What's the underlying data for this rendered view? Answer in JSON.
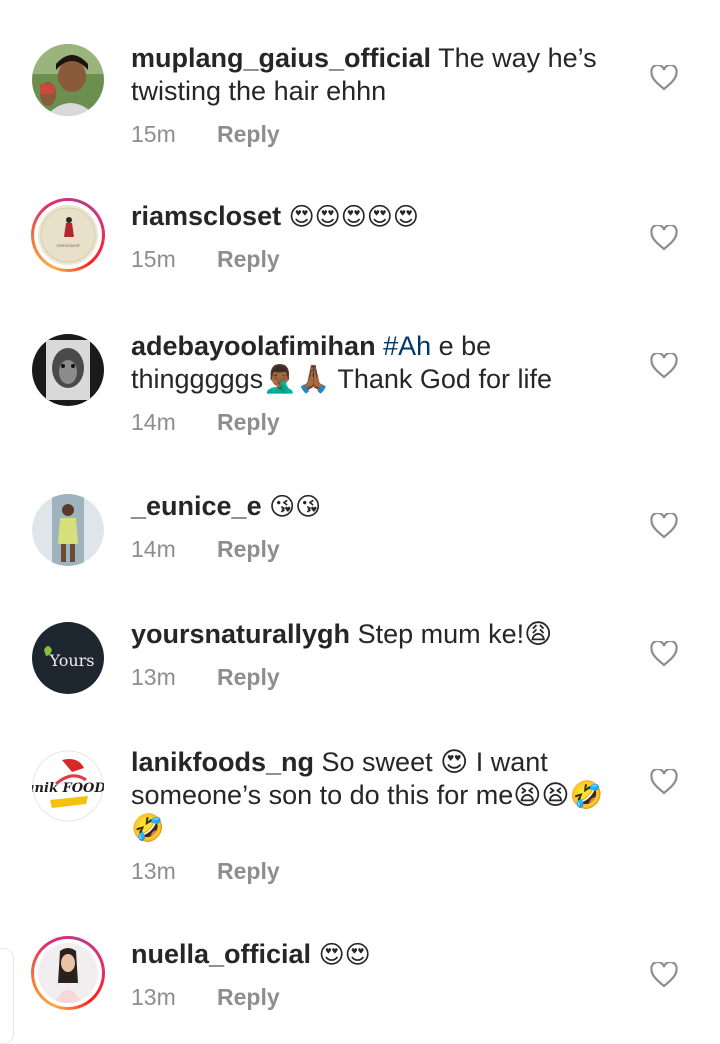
{
  "reply_label": "Reply",
  "comments": [
    {
      "username": "muplang_gaius_official",
      "text": "The way he’s twisting the hair ehhn",
      "time": "15m",
      "avatar": "portrait-woman"
    },
    {
      "username": "riamscloset",
      "text": "😍😍😍😍😍",
      "time": "15m",
      "avatar": "boutique-logo",
      "avatar_caption": "riamscloset"
    },
    {
      "username": "adebayoolafimihan",
      "hashtag": "#Ah",
      "text": "e be thingggggs🤦🏾‍♂️🙏🏾 Thank God for life",
      "time": "14m",
      "avatar": "lion-portrait"
    },
    {
      "username": "_eunice_e",
      "text": "😘😘",
      "time": "14m",
      "avatar": "full-body-photo"
    },
    {
      "username": "yoursnaturallygh",
      "text": "Step mum ke!😩",
      "time": "13m",
      "avatar": "yours-logo",
      "avatar_caption": "Yours"
    },
    {
      "username": "lanikfoods_ng",
      "text": "So sweet 😍 I want someone’s son to do this for me😫😫🤣🤣",
      "time": "13m",
      "avatar": "lanik-foods-logo",
      "avatar_caption": "Lanik FOODS"
    },
    {
      "username": "nuella_official",
      "text": "😍😍",
      "time": "13m",
      "avatar": "portrait-woman-story"
    }
  ],
  "colors": {
    "text": "#262626",
    "meta": "#8e8e8e",
    "hashtag": "#00376b",
    "story_ring": "#e1306c"
  },
  "icons": {
    "like": "heart-outline-icon"
  }
}
